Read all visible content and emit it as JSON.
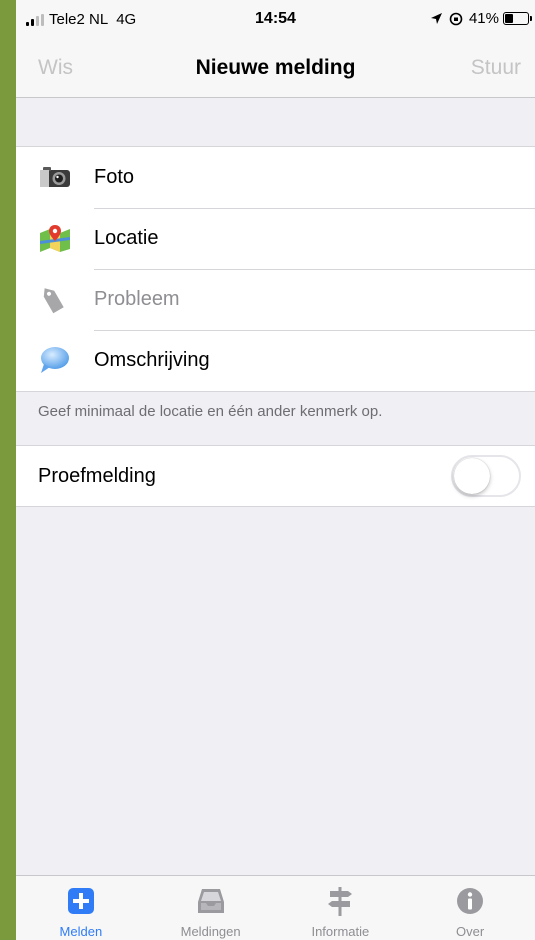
{
  "status_bar": {
    "carrier": "Tele2 NL",
    "network": "4G",
    "time": "14:54",
    "battery": "41%",
    "battery_level": 0.41,
    "signal_bars": 2
  },
  "nav": {
    "left_label": "Wis",
    "title": "Nieuwe melding",
    "right_label": "Stuur"
  },
  "form": {
    "rows": [
      {
        "label": "Foto",
        "icon": "camera-icon"
      },
      {
        "label": "Locatie",
        "icon": "map-pin-icon"
      },
      {
        "label": "Probleem",
        "icon": "tag-icon",
        "muted": true
      },
      {
        "label": "Omschrijving",
        "icon": "speech-bubble-icon"
      }
    ],
    "footnote": "Geef minimaal de locatie en één ander kenmerk op.",
    "test_toggle": {
      "label": "Proefmelding",
      "on": false
    }
  },
  "tabs": [
    {
      "label": "Melden",
      "icon": "plus-square-icon",
      "active": true
    },
    {
      "label": "Meldingen",
      "icon": "inbox-icon",
      "active": false
    },
    {
      "label": "Informatie",
      "icon": "signpost-icon",
      "active": false
    },
    {
      "label": "Over",
      "icon": "info-icon",
      "active": false
    }
  ],
  "colors": {
    "accent": "#2f7cf6",
    "background": "#efeff4",
    "frame": "#7b9a3e",
    "disabled_text": "#c4c4c6"
  }
}
